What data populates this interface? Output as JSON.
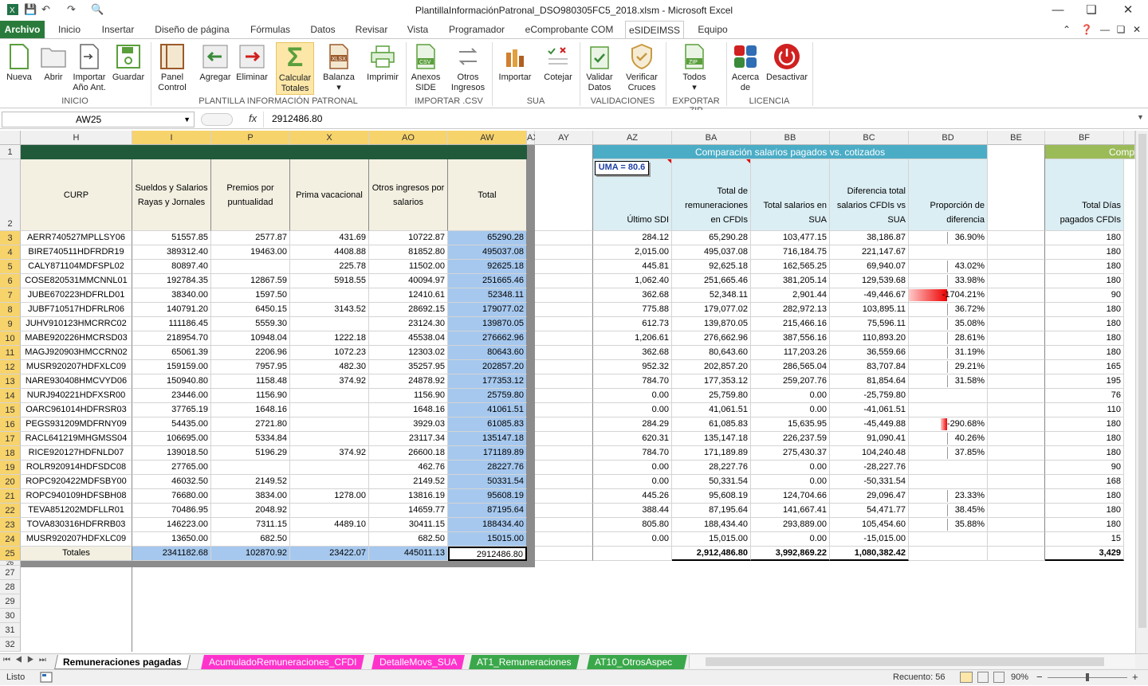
{
  "window": {
    "title": "PlantillaInformaciónPatronal_DSO980305FC5_2018.xlsm - Microsoft Excel"
  },
  "ribbon_tabs": [
    "Archivo",
    "Inicio",
    "Insertar",
    "Diseño de página",
    "Fórmulas",
    "Datos",
    "Revisar",
    "Vista",
    "Programador",
    "eComprobante COM",
    "eSIDEIMSS",
    "Equipo"
  ],
  "ribbon": {
    "buttons": [
      {
        "l1": "Nueva",
        "l2": ""
      },
      {
        "l1": "Abrir",
        "l2": ""
      },
      {
        "l1": "Importar",
        "l2": "Año Ant."
      },
      {
        "l1": "Guardar",
        "l2": ""
      },
      {
        "l1": "Panel",
        "l2": "Control"
      },
      {
        "l1": "Agregar",
        "l2": ""
      },
      {
        "l1": "Eliminar",
        "l2": ""
      },
      {
        "l1": "Calcular",
        "l2": "Totales"
      },
      {
        "l1": "Balanza",
        "l2": ""
      },
      {
        "l1": "Imprimir",
        "l2": ""
      },
      {
        "l1": "Anexos",
        "l2": "SIDE"
      },
      {
        "l1": "Otros",
        "l2": "Ingresos"
      },
      {
        "l1": "Importar",
        "l2": ""
      },
      {
        "l1": "Cotejar",
        "l2": ""
      },
      {
        "l1": "Validar",
        "l2": "Datos"
      },
      {
        "l1": "Verificar",
        "l2": "Cruces"
      },
      {
        "l1": "Todos",
        "l2": ""
      },
      {
        "l1": "Acerca",
        "l2": "de"
      },
      {
        "l1": "Desactivar",
        "l2": ""
      }
    ],
    "groups": [
      "INICIO",
      "PLANTILLA INFORMACIÓN PATRONAL",
      "IMPORTAR .CSV",
      "SUA",
      "VALIDACIONES",
      "EXPORTAR ZIP",
      "LICENCIA"
    ]
  },
  "formula_bar": {
    "name_box": "AW25",
    "fx": "fx",
    "value": "2912486.80"
  },
  "columns": [
    "H",
    "I",
    "P",
    "X",
    "AO",
    "AW",
    "AX",
    "AY",
    "AZ",
    "BA",
    "BB",
    "BC",
    "BD",
    "BE",
    "BF"
  ],
  "row_numbers": [
    "1",
    "2",
    "3",
    "4",
    "5",
    "6",
    "7",
    "8",
    "9",
    "10",
    "11",
    "12",
    "13",
    "14",
    "15",
    "16",
    "17",
    "18",
    "19",
    "20",
    "21",
    "22",
    "23",
    "24",
    "25",
    "26",
    "27",
    "28",
    "29",
    "30",
    "31",
    "32"
  ],
  "headers_left": [
    "CURP",
    "Sueldos y Salarios Rayas y Jornales",
    "Premios por puntualidad",
    "Prima vacacional",
    "Otros ingresos por salarios",
    "Total"
  ],
  "comparison": {
    "banner": "Comparación salarios pagados vs. cotizados",
    "banner2": "Comp",
    "uma_box": "UMA = 80.6",
    "headers": [
      "Último SDI",
      "Total de remuneraciones en CFDIs",
      "Total salarios en SUA",
      "Diferencia total salarios CFDIs vs SUA",
      "Proporción de diferencia"
    ],
    "bf_header": "Total Días pagados CFDIs"
  },
  "rows": [
    [
      "AERR740527MPLLSY06",
      "51557.85",
      "2577.87",
      "431.69",
      "10722.87",
      "65290.28",
      "284.12",
      "65,290.28",
      "103,477.15",
      "38,186.87",
      "36.90%",
      "180"
    ],
    [
      "BIRE740511HDFRDR19",
      "389312.40",
      "19463.00",
      "4408.88",
      "81852.80",
      "495037.08",
      "2,015.00",
      "495,037.08",
      "716,184.75",
      "221,147.67",
      "",
      "180"
    ],
    [
      "CALY871104MDFSPL02",
      "80897.40",
      "",
      "225.78",
      "11502.00",
      "92625.18",
      "445.81",
      "92,625.18",
      "162,565.25",
      "69,940.07",
      "43.02%",
      "180"
    ],
    [
      "COSE820531MMCNNL01",
      "192784.35",
      "12867.59",
      "5918.55",
      "40094.97",
      "251665.46",
      "1,062.40",
      "251,665.46",
      "381,205.14",
      "129,539.68",
      "33.98%",
      "180"
    ],
    [
      "JUBE670223HDFRLD01",
      "38340.00",
      "1597.50",
      "",
      "12410.61",
      "52348.11",
      "362.68",
      "52,348.11",
      "2,901.44",
      "-49,446.67",
      "-1704.21%",
      "90"
    ],
    [
      "JUBF710517HDFRLR06",
      "140791.20",
      "6450.15",
      "3143.52",
      "28692.15",
      "179077.02",
      "775.88",
      "179,077.02",
      "282,972.13",
      "103,895.11",
      "36.72%",
      "180"
    ],
    [
      "JUHV910123HMCRRC02",
      "111186.45",
      "5559.30",
      "",
      "23124.30",
      "139870.05",
      "612.73",
      "139,870.05",
      "215,466.16",
      "75,596.11",
      "35.08%",
      "180"
    ],
    [
      "MABE920226HMCRSD03",
      "218954.70",
      "10948.04",
      "1222.18",
      "45538.04",
      "276662.96",
      "1,206.61",
      "276,662.96",
      "387,556.16",
      "110,893.20",
      "28.61%",
      "180"
    ],
    [
      "MAGJ920903HMCCRN02",
      "65061.39",
      "2206.96",
      "1072.23",
      "12303.02",
      "80643.60",
      "362.68",
      "80,643.60",
      "117,203.26",
      "36,559.66",
      "31.19%",
      "180"
    ],
    [
      "MUSR920207HDFXLC09",
      "159159.00",
      "7957.95",
      "482.30",
      "35257.95",
      "202857.20",
      "952.32",
      "202,857.20",
      "286,565.04",
      "83,707.84",
      "29.21%",
      "165"
    ],
    [
      "NARE930408HMCVYD06",
      "150940.80",
      "1158.48",
      "374.92",
      "24878.92",
      "177353.12",
      "784.70",
      "177,353.12",
      "259,207.76",
      "81,854.64",
      "31.58%",
      "195"
    ],
    [
      "NURJ940221HDFXSR00",
      "23446.00",
      "1156.90",
      "",
      "1156.90",
      "25759.80",
      "0.00",
      "25,759.80",
      "0.00",
      "-25,759.80",
      "",
      "76"
    ],
    [
      "OARC961014HDFRSR03",
      "37765.19",
      "1648.16",
      "",
      "1648.16",
      "41061.51",
      "0.00",
      "41,061.51",
      "0.00",
      "-41,061.51",
      "",
      "110"
    ],
    [
      "PEGS931209MDFRNY09",
      "54435.00",
      "2721.80",
      "",
      "3929.03",
      "61085.83",
      "284.29",
      "61,085.83",
      "15,635.95",
      "-45,449.88",
      "-290.68%",
      "180"
    ],
    [
      "RACL641219MHGMSS04",
      "106695.00",
      "5334.84",
      "",
      "23117.34",
      "135147.18",
      "620.31",
      "135,147.18",
      "226,237.59",
      "91,090.41",
      "40.26%",
      "180"
    ],
    [
      "RICE920127HDFNLD07",
      "139018.50",
      "5196.29",
      "374.92",
      "26600.18",
      "171189.89",
      "784.70",
      "171,189.89",
      "275,430.37",
      "104,240.48",
      "37.85%",
      "180"
    ],
    [
      "ROLR920914HDFSDC08",
      "27765.00",
      "",
      "",
      "462.76",
      "28227.76",
      "0.00",
      "28,227.76",
      "0.00",
      "-28,227.76",
      "",
      "90"
    ],
    [
      "ROPC920422MDFSBY00",
      "46032.50",
      "2149.52",
      "",
      "2149.52",
      "50331.54",
      "0.00",
      "50,331.54",
      "0.00",
      "-50,331.54",
      "",
      "168"
    ],
    [
      "ROPC940109HDFSBH08",
      "76680.00",
      "3834.00",
      "1278.00",
      "13816.19",
      "95608.19",
      "445.26",
      "95,608.19",
      "124,704.66",
      "29,096.47",
      "23.33%",
      "180"
    ],
    [
      "TEVA851202MDFLLR01",
      "70486.95",
      "2048.92",
      "",
      "14659.77",
      "87195.64",
      "388.44",
      "87,195.64",
      "141,667.41",
      "54,471.77",
      "38.45%",
      "180"
    ],
    [
      "TOVA830316HDFRRB03",
      "146223.00",
      "7311.15",
      "4489.10",
      "30411.15",
      "188434.40",
      "805.80",
      "188,434.40",
      "293,889.00",
      "105,454.60",
      "35.88%",
      "180"
    ],
    [
      "MUSR920207HDFXLC09",
      "13650.00",
      "682.50",
      "",
      "682.50",
      "15015.00",
      "0.00",
      "15,015.00",
      "0.00",
      "-15,015.00",
      "",
      "15"
    ]
  ],
  "totals": {
    "label": "Totales",
    "I": "2341182.68",
    "P": "102870.92",
    "X": "23422.07",
    "AO": "445011.13",
    "AW": "2912486.80",
    "BA": "2,912,486.80",
    "BB": "3,992,869.22",
    "BC": "1,080,382.42",
    "BF": "3,429"
  },
  "sheet_tabs": [
    "Remuneraciones pagadas",
    "AcumuladoRemuneraciones_CFDI",
    "DetalleMovs_SUA",
    "AT1_Remuneraciones",
    "AT10_OtrosAspec"
  ],
  "status": {
    "ready": "Listo",
    "count": "Recuento: 56",
    "zoom": "90%"
  },
  "colors": {
    "header_dark": "#215a3b",
    "header_cream": "#f3f0e2",
    "total_blue": "#a6c8ee",
    "banner_teal": "#4bacc6",
    "cell_lightblue": "#dbeef4",
    "banner_green": "#9bbb59",
    "accent_excel": "#2a7b3b"
  }
}
